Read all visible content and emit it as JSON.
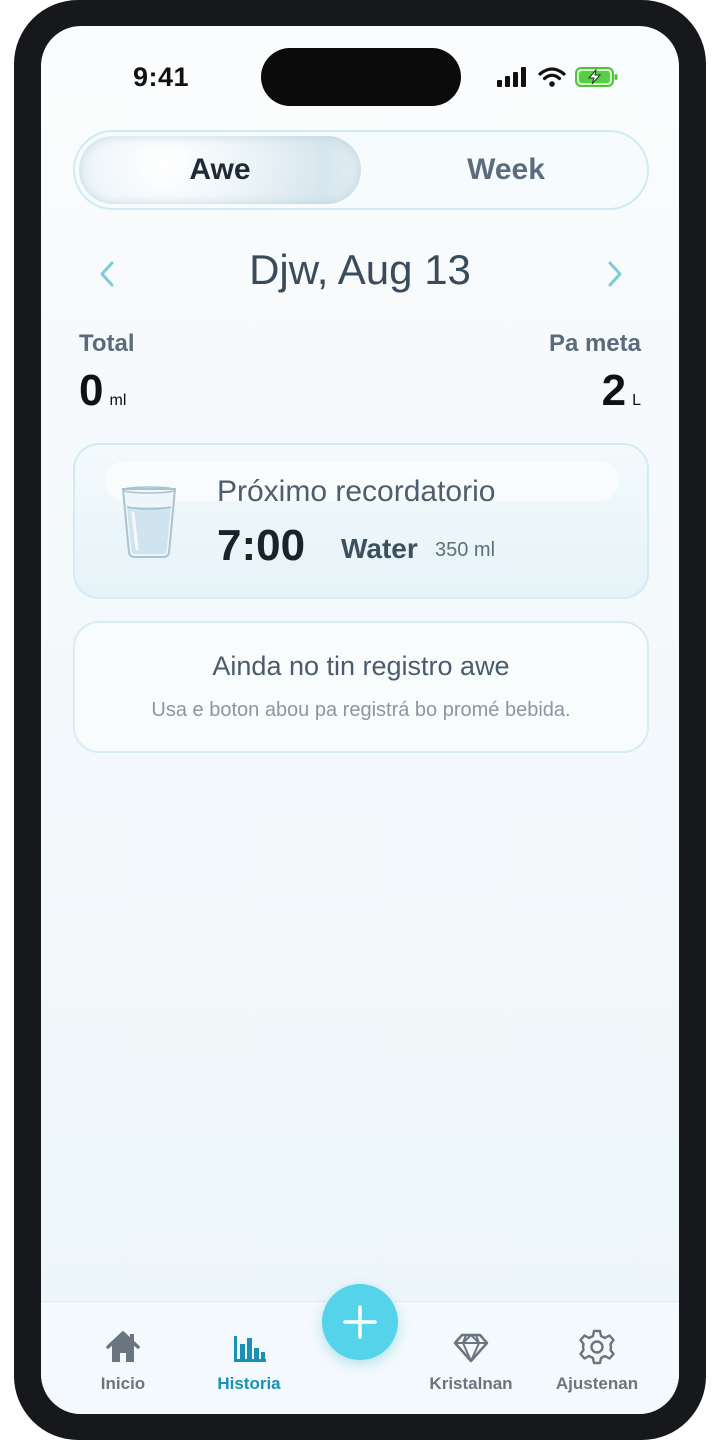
{
  "status_bar": {
    "time": "9:41"
  },
  "segmented": {
    "day_label": "Awe",
    "week_label": "Week",
    "selected": "Awe"
  },
  "date_nav": {
    "date": "Djw, Aug 13"
  },
  "totals": {
    "total_label": "Total",
    "total_value": "0",
    "total_unit": "ml",
    "goal_label": "Pa meta",
    "goal_value": "2",
    "goal_unit": "L"
  },
  "reminder": {
    "title": "Próximo recordatorio",
    "time": "7:00",
    "drink": "Water",
    "amount": "350 ml"
  },
  "empty_state": {
    "title": "Ainda no tin registro awe",
    "subtitle": "Usa e boton abou pa registrá bo promé bebida."
  },
  "tab_bar": {
    "items": [
      {
        "label": "Inicio",
        "icon": "home-icon"
      },
      {
        "label": "Historia",
        "icon": "bar-chart-icon",
        "active": true
      },
      {
        "label": "Kristalnan",
        "icon": "diamond-icon"
      },
      {
        "label": "Ajustenan",
        "icon": "gear-icon"
      }
    ],
    "fab_icon": "plus-icon"
  },
  "colors": {
    "accent": "#1891b2",
    "fab": "#55d3ea",
    "card_border": "#d2ebf2",
    "arrow": "#7ccbd9"
  }
}
